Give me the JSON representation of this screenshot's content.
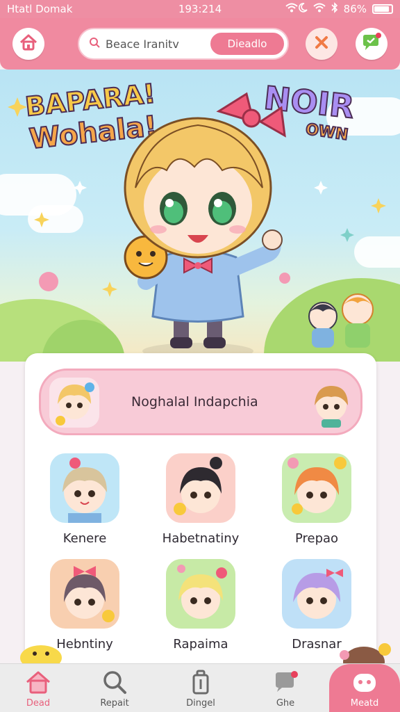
{
  "status_bar": {
    "carrier": "Htatl Domak",
    "time": "193:214",
    "battery_percent": "86%",
    "battery_level": 0.86
  },
  "top_bar": {
    "home_icon": "home-icon",
    "search_placeholder": "Beace Iranitv",
    "search_action": "Dieadlo",
    "close_icon": "close-icon",
    "chat_icon": "chat-icon",
    "colors": {
      "bar": "#f08aa0",
      "pill": "#ee7a93"
    }
  },
  "hero": {
    "burst_left_line1": "BAPARA!",
    "burst_left_line2": "Wohala!",
    "burst_right_line1": "NOIR",
    "burst_right_line2": "OWN"
  },
  "panel": {
    "header_title": "Noghalal Indapchia",
    "items": [
      {
        "label": "Kenere"
      },
      {
        "label": "Habetnatiny"
      },
      {
        "label": "Prepao"
      },
      {
        "label": "Hebntiny"
      },
      {
        "label": "Rapaima"
      },
      {
        "label": "Drasnar"
      }
    ]
  },
  "bottom_nav": {
    "items": [
      {
        "label": "Dead",
        "icon": "house-icon"
      },
      {
        "label": "Repait",
        "icon": "search-icon"
      },
      {
        "label": "Dingel",
        "icon": "trash-icon"
      },
      {
        "label": "Ghe",
        "icon": "chat-bubble-icon"
      },
      {
        "label": "Meatd",
        "icon": "profile-icon"
      }
    ]
  }
}
